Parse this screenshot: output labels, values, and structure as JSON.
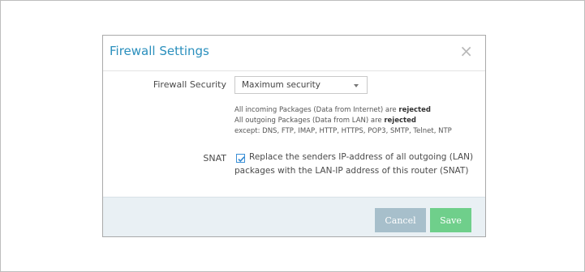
{
  "dialog": {
    "title": "Firewall Settings",
    "close_symbol": "×"
  },
  "firewall": {
    "label": "Firewall Security",
    "selected": "Maximum security"
  },
  "info": {
    "line1_text": "All incoming Packages (Data from Internet) are ",
    "line1_bold": "rejected",
    "line2_text": "All outgoing Packages (Data from LAN) are ",
    "line2_bold": "rejected",
    "line3": "except: DNS, FTP, IMAP, HTTP, HTTPS, POP3, SMTP, Telnet, NTP"
  },
  "snat": {
    "label": "SNAT",
    "checked": true,
    "text_line1": "Replace the senders IP-address of all outgoing (LAN)",
    "text_line2": "packages with the LAN-IP address of this router (SNAT)"
  },
  "footer": {
    "cancel_label": "Cancel",
    "save_label": "Save"
  },
  "colors": {
    "title": "#2a8fbd",
    "cancel": "#a7bfcb",
    "save": "#6fcf8b",
    "footer_bg": "#e9f0f4"
  }
}
